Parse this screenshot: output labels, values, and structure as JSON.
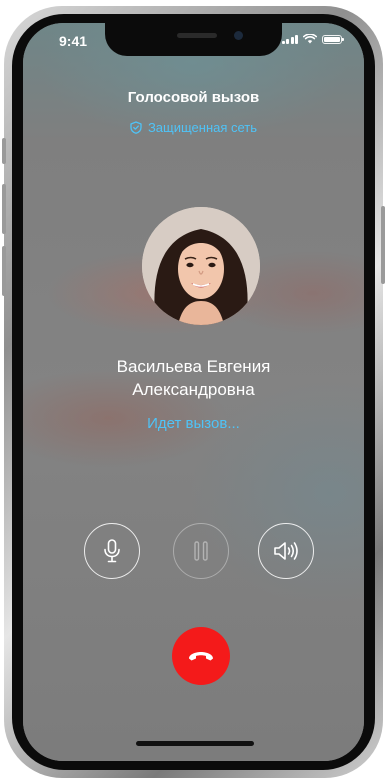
{
  "status_bar": {
    "time": "9:41",
    "icons": [
      "signal-icon",
      "wifi-icon",
      "battery-icon"
    ]
  },
  "call": {
    "type_title": "Голосовой вызов",
    "secure_label": "Защищенная сеть",
    "contact_name_line1": "Васильева Евгения",
    "contact_name_line2": "Александровна",
    "status": "Идет вызов..."
  },
  "controls": [
    {
      "name": "mute-button",
      "icon": "microphone-icon",
      "enabled": true
    },
    {
      "name": "hold-button",
      "icon": "pause-icon",
      "enabled": false
    },
    {
      "name": "speaker-button",
      "icon": "speaker-icon",
      "enabled": true
    }
  ],
  "end_call": {
    "icon": "hang-up-icon"
  },
  "colors": {
    "accent": "#4fc3f7",
    "end_call": "#f41a1a",
    "text": "#ffffff"
  }
}
